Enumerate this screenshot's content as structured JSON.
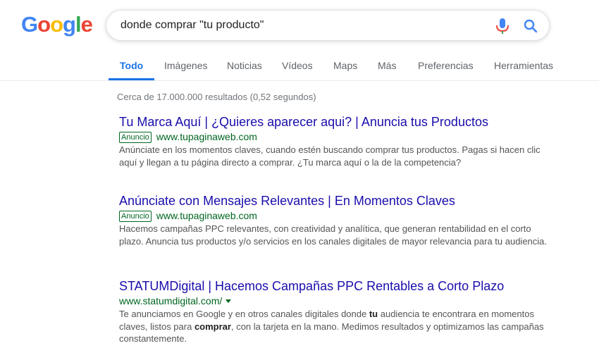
{
  "logo": {
    "letters": [
      "G",
      "o",
      "o",
      "g",
      "l",
      "e"
    ],
    "colors": [
      "#4285F4",
      "#EA4335",
      "#FBBC05",
      "#4285F4",
      "#34A853",
      "#EA4335"
    ]
  },
  "search": {
    "query": "donde comprar \"tu producto\""
  },
  "tabs": [
    {
      "label": "Todo",
      "active": true
    },
    {
      "label": "Imágenes"
    },
    {
      "label": "Noticias"
    },
    {
      "label": "Vídeos"
    },
    {
      "label": "Maps"
    },
    {
      "label": "Más"
    },
    {
      "label": "Preferencias"
    },
    {
      "label": "Herramientas"
    }
  ],
  "stats": "Cerca de 17.000.000 resultados (0,52 segundos)",
  "results": [
    {
      "title": "Tu Marca Aquí | ¿Quieres aparecer aqui? | Anuncia tus Productos",
      "badge": "Anuncio",
      "url": "www.tupaginaweb.com",
      "snippet": "Anúnciate en los momentos claves, cuando estén buscando comprar tus productos. Pagas si hacen clic aquí y llegan a tu página directo a comprar. ¿Tu marca aquí o la de la competencia?"
    },
    {
      "title": "Anúnciate con Mensajes Relevantes | En Momentos Claves",
      "badge": "Anuncio",
      "url": "www.tupaginaweb.com",
      "snippet": "Hacemos campañas PPC relevantes, con creatividad y analítica, que generan rentabilidad en el corto plazo. Anuncia tus productos y/o servicios en los canales digitales de mayor relevancia para tu audiencia."
    },
    {
      "title": "STATUMDigital | Hacemos Campañas PPC Rentables a Corto Plazo",
      "url": "www.statumdigital.com/",
      "snippet_parts": [
        {
          "t": "Te anunciamos en Google y en otros canales digitales donde "
        },
        {
          "t": "tu",
          "b": true
        },
        {
          "t": " audiencia te encontrara en momentos claves, listos para "
        },
        {
          "t": "comprar",
          "b": true
        },
        {
          "t": ", con la tarjeta en la mano. Medimos resultados y optimizamos las campañas constantemente."
        }
      ]
    }
  ]
}
